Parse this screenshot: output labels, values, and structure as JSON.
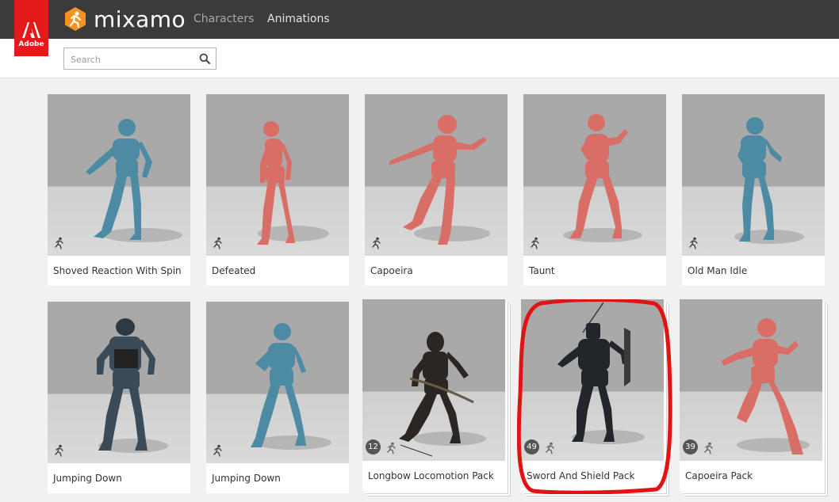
{
  "header": {
    "adobe_label": "Adobe",
    "brand": "mixamo",
    "nav": {
      "characters": "Characters",
      "animations": "Animations"
    }
  },
  "search": {
    "placeholder": "Search",
    "value": ""
  },
  "colors": {
    "topbar": "#3b3b3b",
    "adobe_red": "#e41a1a",
    "brand_orange": "#f7921e",
    "highlight_red": "#e01414",
    "blue_model": "#4d8aa3",
    "red_model": "#d96e66"
  },
  "row1": [
    {
      "title": "Shoved Reaction With Spin",
      "model": "blue"
    },
    {
      "title": "Defeated",
      "model": "red"
    },
    {
      "title": "Capoeira",
      "model": "red"
    },
    {
      "title": "Taunt",
      "model": "red"
    },
    {
      "title": "Old Man Idle",
      "model": "blue"
    }
  ],
  "row2": [
    {
      "title": "Jumping Down",
      "model": "soldier"
    },
    {
      "title": "Jumping Down",
      "model": "blue"
    },
    {
      "title": "Longbow Locomotion Pack",
      "model": "archer",
      "count": "12"
    },
    {
      "title": "Sword And Shield Pack",
      "model": "knight",
      "count": "49"
    },
    {
      "title": "Capoeira Pack",
      "model": "red",
      "count": "39"
    }
  ]
}
